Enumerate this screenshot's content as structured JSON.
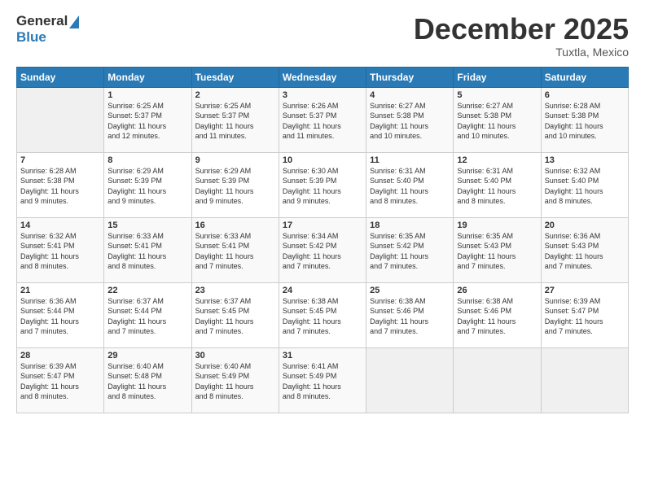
{
  "header": {
    "logo_general": "General",
    "logo_blue": "Blue",
    "month_title": "December 2025",
    "subtitle": "Tuxtla, Mexico"
  },
  "days_of_week": [
    "Sunday",
    "Monday",
    "Tuesday",
    "Wednesday",
    "Thursday",
    "Friday",
    "Saturday"
  ],
  "weeks": [
    {
      "days": [
        {
          "number": "",
          "info": ""
        },
        {
          "number": "1",
          "info": "Sunrise: 6:25 AM\nSunset: 5:37 PM\nDaylight: 11 hours\nand 12 minutes."
        },
        {
          "number": "2",
          "info": "Sunrise: 6:25 AM\nSunset: 5:37 PM\nDaylight: 11 hours\nand 11 minutes."
        },
        {
          "number": "3",
          "info": "Sunrise: 6:26 AM\nSunset: 5:37 PM\nDaylight: 11 hours\nand 11 minutes."
        },
        {
          "number": "4",
          "info": "Sunrise: 6:27 AM\nSunset: 5:38 PM\nDaylight: 11 hours\nand 10 minutes."
        },
        {
          "number": "5",
          "info": "Sunrise: 6:27 AM\nSunset: 5:38 PM\nDaylight: 11 hours\nand 10 minutes."
        },
        {
          "number": "6",
          "info": "Sunrise: 6:28 AM\nSunset: 5:38 PM\nDaylight: 11 hours\nand 10 minutes."
        }
      ]
    },
    {
      "days": [
        {
          "number": "7",
          "info": "Sunrise: 6:28 AM\nSunset: 5:38 PM\nDaylight: 11 hours\nand 9 minutes."
        },
        {
          "number": "8",
          "info": "Sunrise: 6:29 AM\nSunset: 5:39 PM\nDaylight: 11 hours\nand 9 minutes."
        },
        {
          "number": "9",
          "info": "Sunrise: 6:29 AM\nSunset: 5:39 PM\nDaylight: 11 hours\nand 9 minutes."
        },
        {
          "number": "10",
          "info": "Sunrise: 6:30 AM\nSunset: 5:39 PM\nDaylight: 11 hours\nand 9 minutes."
        },
        {
          "number": "11",
          "info": "Sunrise: 6:31 AM\nSunset: 5:40 PM\nDaylight: 11 hours\nand 8 minutes."
        },
        {
          "number": "12",
          "info": "Sunrise: 6:31 AM\nSunset: 5:40 PM\nDaylight: 11 hours\nand 8 minutes."
        },
        {
          "number": "13",
          "info": "Sunrise: 6:32 AM\nSunset: 5:40 PM\nDaylight: 11 hours\nand 8 minutes."
        }
      ]
    },
    {
      "days": [
        {
          "number": "14",
          "info": "Sunrise: 6:32 AM\nSunset: 5:41 PM\nDaylight: 11 hours\nand 8 minutes."
        },
        {
          "number": "15",
          "info": "Sunrise: 6:33 AM\nSunset: 5:41 PM\nDaylight: 11 hours\nand 8 minutes."
        },
        {
          "number": "16",
          "info": "Sunrise: 6:33 AM\nSunset: 5:41 PM\nDaylight: 11 hours\nand 7 minutes."
        },
        {
          "number": "17",
          "info": "Sunrise: 6:34 AM\nSunset: 5:42 PM\nDaylight: 11 hours\nand 7 minutes."
        },
        {
          "number": "18",
          "info": "Sunrise: 6:35 AM\nSunset: 5:42 PM\nDaylight: 11 hours\nand 7 minutes."
        },
        {
          "number": "19",
          "info": "Sunrise: 6:35 AM\nSunset: 5:43 PM\nDaylight: 11 hours\nand 7 minutes."
        },
        {
          "number": "20",
          "info": "Sunrise: 6:36 AM\nSunset: 5:43 PM\nDaylight: 11 hours\nand 7 minutes."
        }
      ]
    },
    {
      "days": [
        {
          "number": "21",
          "info": "Sunrise: 6:36 AM\nSunset: 5:44 PM\nDaylight: 11 hours\nand 7 minutes."
        },
        {
          "number": "22",
          "info": "Sunrise: 6:37 AM\nSunset: 5:44 PM\nDaylight: 11 hours\nand 7 minutes."
        },
        {
          "number": "23",
          "info": "Sunrise: 6:37 AM\nSunset: 5:45 PM\nDaylight: 11 hours\nand 7 minutes."
        },
        {
          "number": "24",
          "info": "Sunrise: 6:38 AM\nSunset: 5:45 PM\nDaylight: 11 hours\nand 7 minutes."
        },
        {
          "number": "25",
          "info": "Sunrise: 6:38 AM\nSunset: 5:46 PM\nDaylight: 11 hours\nand 7 minutes."
        },
        {
          "number": "26",
          "info": "Sunrise: 6:38 AM\nSunset: 5:46 PM\nDaylight: 11 hours\nand 7 minutes."
        },
        {
          "number": "27",
          "info": "Sunrise: 6:39 AM\nSunset: 5:47 PM\nDaylight: 11 hours\nand 7 minutes."
        }
      ]
    },
    {
      "days": [
        {
          "number": "28",
          "info": "Sunrise: 6:39 AM\nSunset: 5:47 PM\nDaylight: 11 hours\nand 8 minutes."
        },
        {
          "number": "29",
          "info": "Sunrise: 6:40 AM\nSunset: 5:48 PM\nDaylight: 11 hours\nand 8 minutes."
        },
        {
          "number": "30",
          "info": "Sunrise: 6:40 AM\nSunset: 5:49 PM\nDaylight: 11 hours\nand 8 minutes."
        },
        {
          "number": "31",
          "info": "Sunrise: 6:41 AM\nSunset: 5:49 PM\nDaylight: 11 hours\nand 8 minutes."
        },
        {
          "number": "",
          "info": ""
        },
        {
          "number": "",
          "info": ""
        },
        {
          "number": "",
          "info": ""
        }
      ]
    }
  ]
}
